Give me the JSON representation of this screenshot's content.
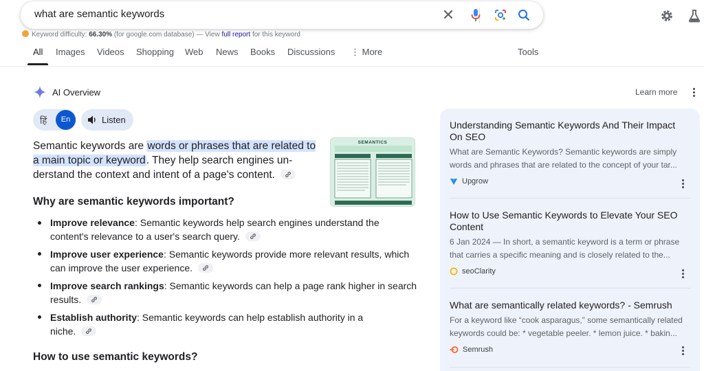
{
  "search": {
    "query": "what are semantic keywords"
  },
  "keyword_difficulty": {
    "label": "Keyword difficulty:",
    "value": "66.30%",
    "db_text": "(for google.com database) — View",
    "link": "full report",
    "suffix": "for this keyword"
  },
  "tabs": [
    {
      "label": "All"
    },
    {
      "label": "Images"
    },
    {
      "label": "Videos"
    },
    {
      "label": "Shopping"
    },
    {
      "label": "Web"
    },
    {
      "label": "News"
    },
    {
      "label": "Books"
    },
    {
      "label": "Discussions"
    },
    {
      "label": "More"
    }
  ],
  "tools_label": "Tools",
  "ai_overview": {
    "title": "AI Overview",
    "learn_more": "Learn more",
    "lang_hi": "हिं",
    "lang_en": "En",
    "listen": "Listen",
    "para_start": "Semantic keywords are ",
    "para_highlight": "words or phrases that are related to a main topic or keyword",
    "para_end": ". They help search engines un­derstand the context and intent of a page's content.",
    "thumb_title": "SEMANTICS",
    "why_heading": "Why are semantic keywords important?",
    "bullets": [
      {
        "bold": "Improve relevance",
        "text": ": Semantic keywords help search engines understand the content's relevance to a user's search query."
      },
      {
        "bold": "Improve user experience",
        "text": ": Semantic keywords provide more relevant results, which can improve the user experience."
      },
      {
        "bold": "Improve search rankings",
        "text": ": Semantic keywords can help a page rank higher in search results."
      },
      {
        "bold": "Establish authority",
        "text": ": Semantic keywords can help establish authority in a niche."
      }
    ],
    "how_heading": "How to use semantic keywords?"
  },
  "sources": [
    {
      "title": "Understanding Semantic Keywords And Their Impact On SEO",
      "snippet1": "What are Semantic Keywords? Semantic keywords are simply",
      "snippet2": "words and phrases that are related to the concept of your tar...",
      "site": "Upgrow"
    },
    {
      "title": "How to Use Semantic Keywords to Elevate Your SEO Content",
      "snippet1": "6 Jan 2024 — In short, a semantic keyword is a term or phrase",
      "snippet2": "that carries a specific meaning and is closely related to the...",
      "site": "seoClarity"
    },
    {
      "title": "What are semantically related keywords? - Semrush",
      "snippet1": "For a keyword like “cook asparagus,” some semantically related",
      "snippet2": "keywords could be: * vegetable peeler. * lemon juice. * bakin...",
      "site": "Semrush"
    }
  ],
  "colors": {
    "accent": "#0b57d0",
    "highlight": "#d3e3fd",
    "panel": "#eef2fa"
  }
}
